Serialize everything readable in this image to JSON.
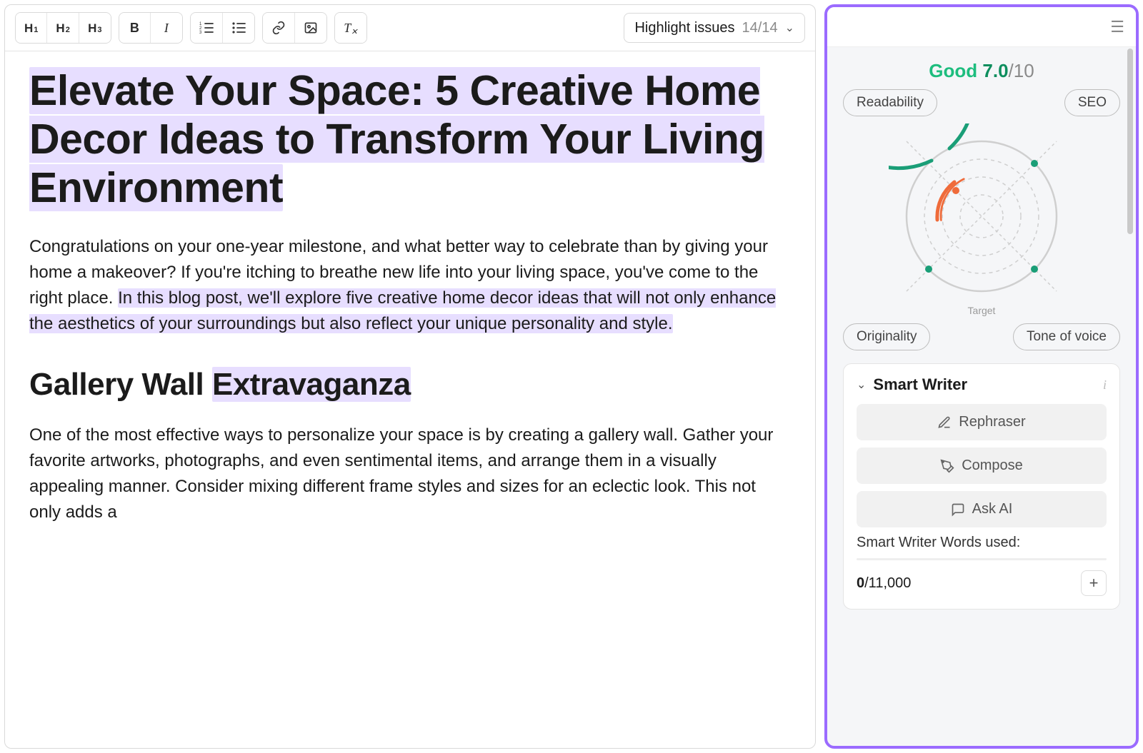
{
  "toolbar": {
    "headings": [
      "H1",
      "H2",
      "H3"
    ],
    "highlight_label": "Highlight issues",
    "highlight_count": "14/14"
  },
  "document": {
    "title": "Elevate Your Space: 5 Creative Home Decor Ideas to Transform Your Living Environment",
    "para1_a": "Congratulations on your one-year milestone, and what better way to celebrate than by giving your home a makeover? If you're itching to breathe new life into your living space, you've come to the right place. ",
    "para1_b": "In this blog post, we'll explore five creative home decor ideas that will not only enhance the aesthetics of your surroundings but also reflect your unique personality and style.",
    "heading2_a": "Gallery Wall ",
    "heading2_b": "Extravaganza",
    "para2": "One of the most effective ways to personalize your space is by creating a gallery wall. Gather your favorite artworks, photographs, and even sentimental items, and arrange them in a visually appealing manner. Consider mixing different frame styles and sizes for an eclectic look. This not only adds a"
  },
  "sidebar": {
    "score_word": "Good",
    "score_value": "7.0",
    "score_max": "/10",
    "pills": [
      "Readability",
      "SEO",
      "Originality",
      "Tone of voice"
    ],
    "target_label": "Target",
    "smart_writer": {
      "title": "Smart Writer",
      "actions": [
        "Rephraser",
        "Compose",
        "Ask AI"
      ],
      "usage_label": "Smart Writer Words used:",
      "usage_used": "0",
      "usage_max": "/11,000"
    }
  },
  "chart_data": {
    "type": "radar",
    "axes": [
      "Readability",
      "SEO",
      "Tone of voice",
      "Originality"
    ],
    "values_pct_of_target_ring": [
      50,
      95,
      95,
      95
    ],
    "target_ring_pct": 100,
    "note": "Readability segment shown in warning (orange); other three near target (green)."
  }
}
